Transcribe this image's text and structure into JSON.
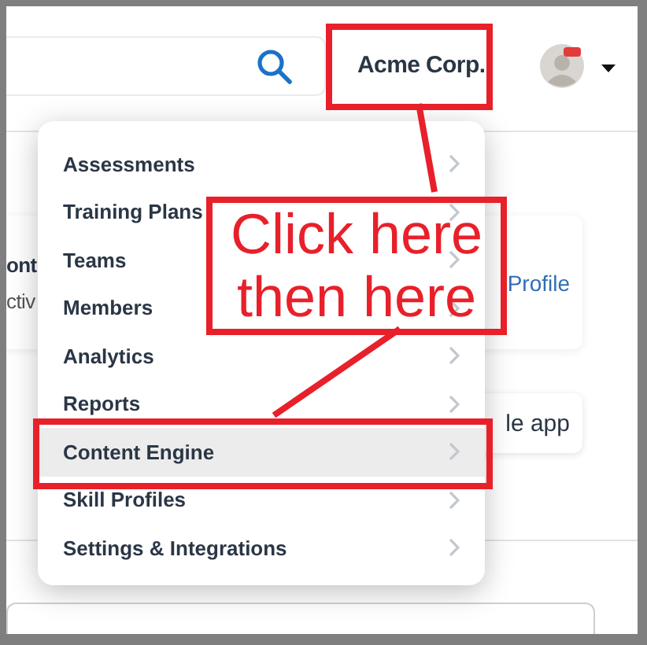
{
  "header": {
    "organization": "Acme Corp."
  },
  "card": {
    "title": "ont",
    "subtitle": "ctiv",
    "link": "Profile"
  },
  "app_button": "le app",
  "menu": {
    "items": [
      {
        "label": "Assessments",
        "selected": false
      },
      {
        "label": "Training Plans",
        "selected": false
      },
      {
        "label": "Teams",
        "selected": false
      },
      {
        "label": "Members",
        "selected": false
      },
      {
        "label": "Analytics",
        "selected": false
      },
      {
        "label": "Reports",
        "selected": false
      },
      {
        "label": "Content Engine",
        "selected": true
      },
      {
        "label": "Skill Profiles",
        "selected": false
      },
      {
        "label": "Settings & Integrations",
        "selected": false
      }
    ]
  },
  "annotation": {
    "note": "Click here then here"
  }
}
